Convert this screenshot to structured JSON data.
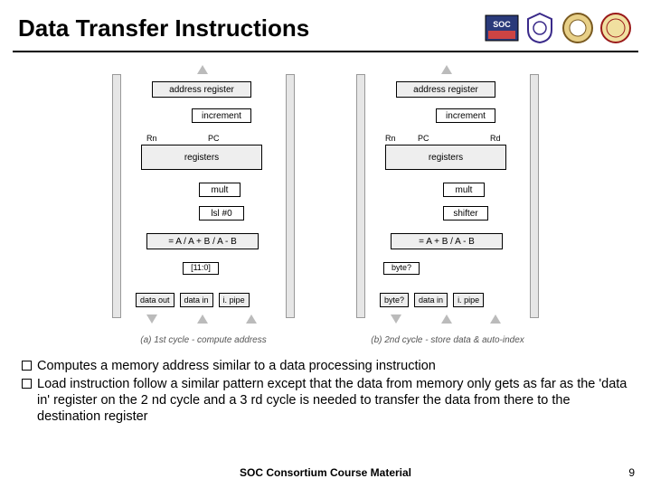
{
  "header": {
    "title": "Data Transfer Instructions"
  },
  "labels": {
    "addr_reg": "address register",
    "increment": "increment",
    "registers": "registers",
    "rn": "Rn",
    "pc": "PC",
    "rd": "Rd",
    "mult": "mult",
    "lsl0": "lsl #0",
    "shifter": "shifter",
    "alu_a": "= A / A + B / A - B",
    "alu_b": "= A + B / A - B",
    "bits": "[11:0]",
    "byteq": "byte?",
    "data_out": "data out",
    "data_in": "data in",
    "ipipe": "i. pipe"
  },
  "captions": {
    "a": "(a) 1st cycle - compute address",
    "b": "(b) 2nd cycle - store data & auto-index"
  },
  "bullets": [
    "Computes a memory address similar to a data processing instruction",
    "Load instruction follow a similar pattern except that the data from memory only gets as far as the 'data in' register on the 2 nd cycle and a 3 rd cycle is needed to transfer the data from there to the destination register"
  ],
  "footer": {
    "course": "SOC Consortium Course Material",
    "page": "9"
  }
}
